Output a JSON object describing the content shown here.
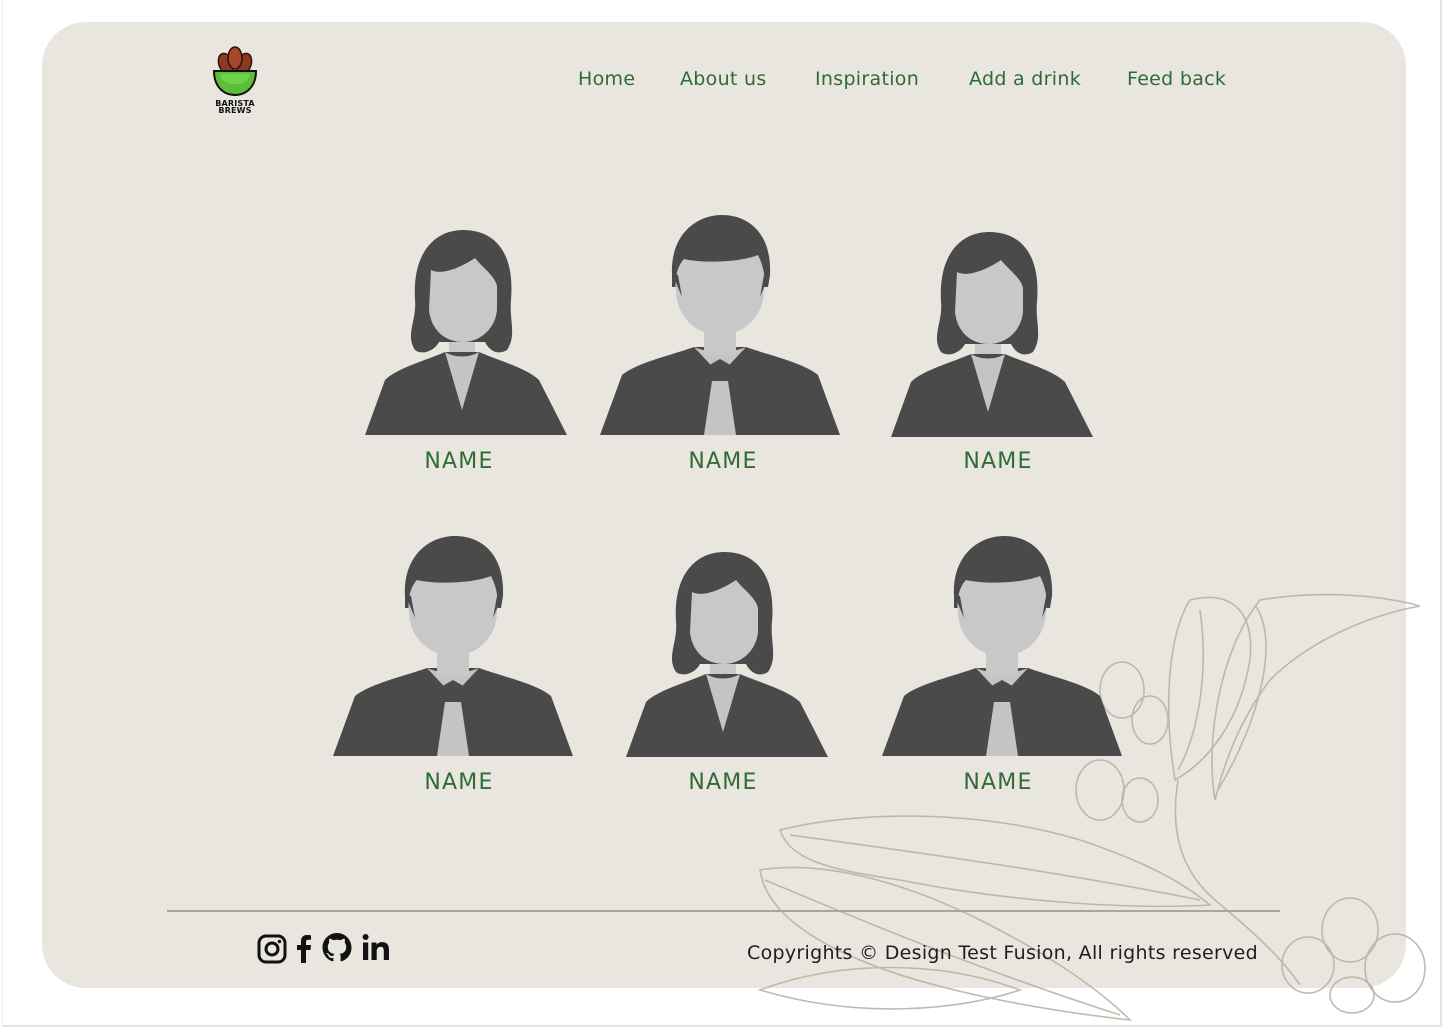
{
  "brand": {
    "logo_line1": "BARISTA",
    "logo_line2": "BREWS"
  },
  "nav": {
    "items": [
      "Home",
      "About us",
      "Inspiration",
      "Add a drink",
      "Feed back"
    ]
  },
  "team": {
    "members": [
      {
        "name": "NAME",
        "avatar": "female-avatar-icon"
      },
      {
        "name": "NAME",
        "avatar": "male-avatar-icon"
      },
      {
        "name": "NAME",
        "avatar": "female-avatar-icon"
      },
      {
        "name": "NAME",
        "avatar": "male-avatar-icon"
      },
      {
        "name": "NAME",
        "avatar": "female-avatar-icon"
      },
      {
        "name": "NAME",
        "avatar": "male-avatar-icon"
      }
    ]
  },
  "footer": {
    "social": [
      "instagram-icon",
      "facebook-icon",
      "github-icon",
      "linkedin-icon"
    ],
    "copyright": "Copyrights © Design Test Fusion, All rights reserved"
  },
  "colors": {
    "card_background": "#e9e6df",
    "accent_green": "#2f6b37",
    "avatar_dark": "#4a4a4a",
    "avatar_light": "#c8c8c8"
  }
}
